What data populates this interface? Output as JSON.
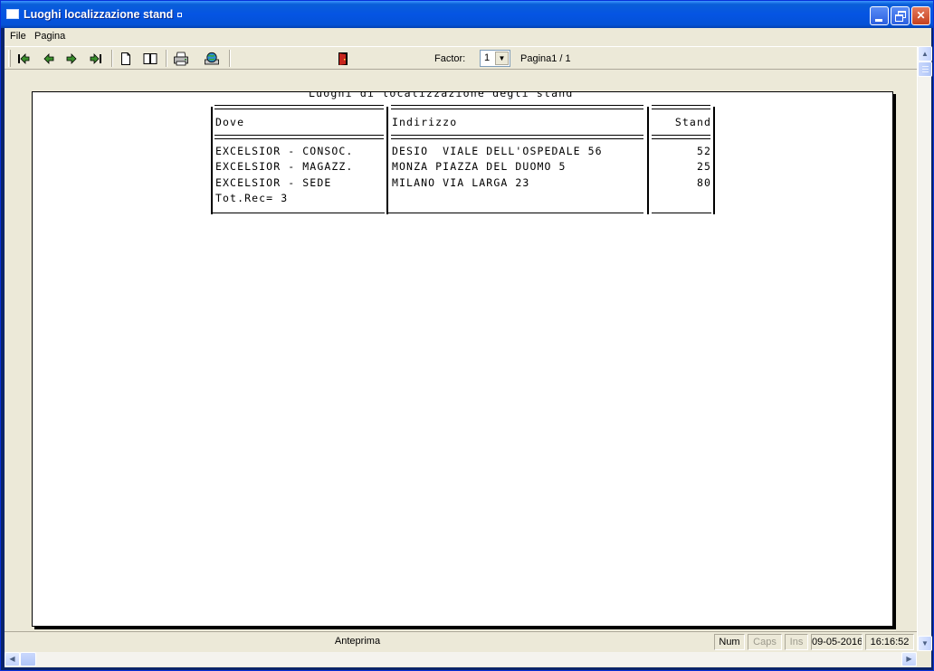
{
  "window": {
    "title": "Luoghi localizzazione stand",
    "minimize_label": "",
    "close_label": "✕"
  },
  "menu": {
    "items": [
      "File",
      "Pagina"
    ]
  },
  "toolbar": {
    "factor_label": "Factor:",
    "factor_value": "1",
    "page_label": "Pagina1 / 1",
    "icons": [
      "first-page-icon",
      "prev-page-icon",
      "next-page-icon",
      "last-page-icon",
      "single-page-icon",
      "two-pages-icon",
      "printer-icon",
      "globe-export-icon",
      "exit-door-icon"
    ]
  },
  "report": {
    "title": "Luoghi di localizzazione degli stand",
    "headers": [
      "Dove",
      "Indirizzo",
      "Stand"
    ],
    "rows": [
      {
        "dove": "EXCELSIOR - CONSOC.",
        "indirizzo": "DESIO  VIALE DELL'OSPEDALE 56",
        "stand": "52"
      },
      {
        "dove": "EXCELSIOR - MAGAZZ.",
        "indirizzo": "MONZA PIAZZA DEL DUOMO 5",
        "stand": "25"
      },
      {
        "dove": "EXCELSIOR - SEDE",
        "indirizzo": "MILANO VIA LARGA 23",
        "stand": "80"
      }
    ],
    "total": "Tot.Rec= 3"
  },
  "status": {
    "main": "Anteprima",
    "num": "Num",
    "caps": "Caps",
    "ins": "Ins",
    "date": "09-05-2016",
    "time": "16:16:52"
  }
}
